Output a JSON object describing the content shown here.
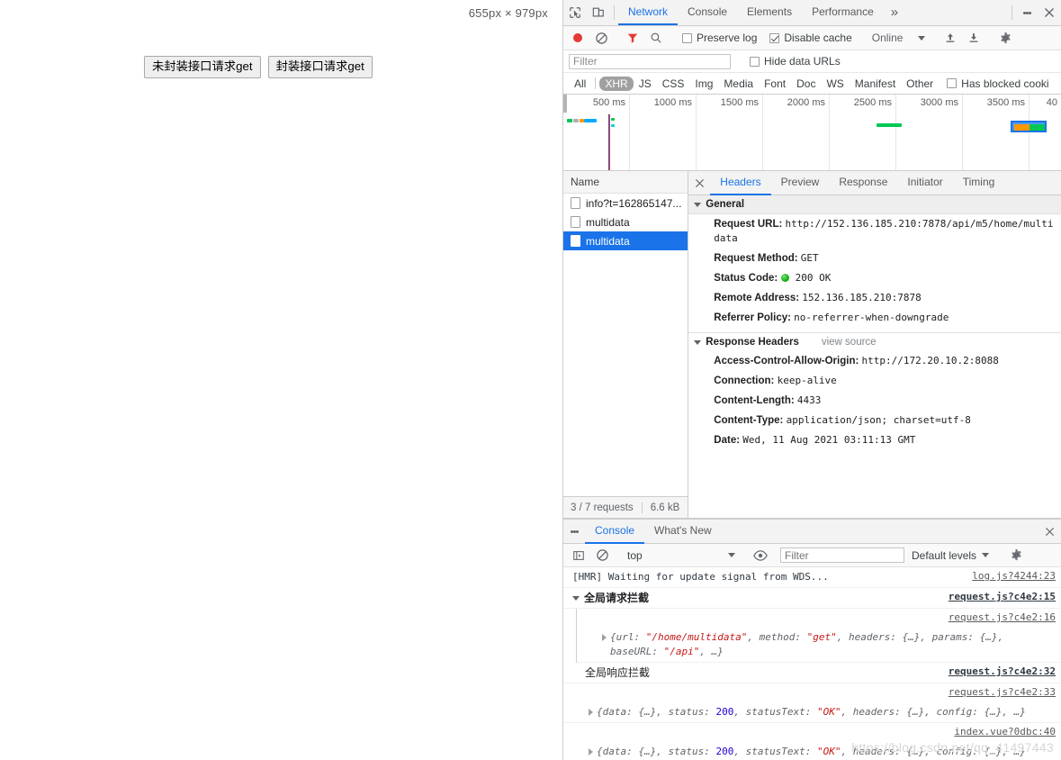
{
  "page": {
    "dimension_badge": "655px × 979px",
    "buttons": [
      {
        "label": "未封装接口请求get"
      },
      {
        "label": "封装接口请求get"
      }
    ]
  },
  "devtools": {
    "main_tabs": [
      {
        "label": "Network",
        "active": true
      },
      {
        "label": "Console",
        "active": false
      },
      {
        "label": "Elements",
        "active": false
      },
      {
        "label": "Performance",
        "active": false
      }
    ],
    "more_tabs_label": "»",
    "icons": {
      "inspect": "inspect-element-icon",
      "device": "device-toolbar-icon",
      "kebab": "more-options-icon",
      "close": "close-devtools-icon"
    },
    "network_toolbar": {
      "record_label": "record-button",
      "clear_label": "clear-button",
      "filter_label": "filter-button",
      "search_label": "search-button",
      "preserve_log": "Preserve log",
      "preserve_log_checked": false,
      "disable_cache": "Disable cache",
      "disable_cache_checked": true,
      "throttling": "Online",
      "import_label": "import-har-icon",
      "export_label": "export-har-icon",
      "settings_label": "settings-icon"
    },
    "filter_row": {
      "filter_placeholder": "Filter",
      "filter_value": "",
      "hide_data_urls": "Hide data URLs",
      "hide_data_urls_checked": false
    },
    "type_filters": [
      {
        "label": "All",
        "active": false
      },
      {
        "label": "XHR",
        "active": true
      },
      {
        "label": "JS",
        "active": false
      },
      {
        "label": "CSS",
        "active": false
      },
      {
        "label": "Img",
        "active": false
      },
      {
        "label": "Media",
        "active": false
      },
      {
        "label": "Font",
        "active": false
      },
      {
        "label": "Doc",
        "active": false
      },
      {
        "label": "WS",
        "active": false
      },
      {
        "label": "Manifest",
        "active": false
      },
      {
        "label": "Other",
        "active": false
      }
    ],
    "blocked_cookies": "Has blocked cooki",
    "blocked_cookies_checked": false,
    "overview": {
      "ticks": [
        "500 ms",
        "1000 ms",
        "1500 ms",
        "2000 ms",
        "2500 ms",
        "3000 ms",
        "3500 ms",
        "40"
      ]
    },
    "requests": {
      "column_name": "Name",
      "rows": [
        {
          "name": "info?t=162865147...",
          "selected": false
        },
        {
          "name": "multidata",
          "selected": false
        },
        {
          "name": "multidata",
          "selected": true
        }
      ],
      "status": {
        "requests": "3 / 7 requests",
        "size": "6.6 kB"
      }
    },
    "details": {
      "tabs": [
        {
          "label": "Headers",
          "active": true
        },
        {
          "label": "Preview",
          "active": false
        },
        {
          "label": "Response",
          "active": false
        },
        {
          "label": "Initiator",
          "active": false
        },
        {
          "label": "Timing",
          "active": false
        }
      ],
      "general": {
        "title": "General",
        "items": [
          {
            "key": "Request URL:",
            "value": "http://152.136.185.210:7878/api/m5/home/multidata"
          },
          {
            "key": "Request Method:",
            "value": "GET"
          },
          {
            "key": "Status Code:",
            "value": "200 OK",
            "has_status_dot": true
          },
          {
            "key": "Remote Address:",
            "value": "152.136.185.210:7878"
          },
          {
            "key": "Referrer Policy:",
            "value": "no-referrer-when-downgrade"
          }
        ]
      },
      "response_headers": {
        "title": "Response Headers",
        "view_source": "view source",
        "items": [
          {
            "key": "Access-Control-Allow-Origin:",
            "value": "http://172.20.10.2:8088"
          },
          {
            "key": "Connection:",
            "value": "keep-alive"
          },
          {
            "key": "Content-Length:",
            "value": "4433"
          },
          {
            "key": "Content-Type:",
            "value": "application/json; charset=utf-8"
          },
          {
            "key": "Date:",
            "value": "Wed, 11 Aug 2021 03:11:13 GMT"
          }
        ]
      }
    },
    "drawer": {
      "tabs": [
        {
          "label": "Console",
          "active": true
        },
        {
          "label": "What's New",
          "active": false
        }
      ],
      "toolbar": {
        "sidebar_label": "console-sidebar-icon",
        "clear_label": "clear-console-icon",
        "context": "top",
        "eye_label": "live-expression-icon",
        "filter_placeholder": "Filter",
        "filter_value": "",
        "levels": "Default levels",
        "settings_label": "console-settings-icon"
      },
      "logs": [
        {
          "type": "plain",
          "message": "[HMR] Waiting for update signal from WDS...",
          "source": "log.js?4244:23"
        },
        {
          "type": "group",
          "message": "全局请求拦截",
          "source": "request.js?c4e2:15"
        },
        {
          "type": "object",
          "source": "request.js?c4e2:16",
          "parts": [
            {
              "t": "{url: ",
              "c": "plain"
            },
            {
              "t": "\"/home/multidata\"",
              "c": "string"
            },
            {
              "t": ", method: ",
              "c": "plain"
            },
            {
              "t": "\"get\"",
              "c": "string"
            },
            {
              "t": ", headers: {…}, params: {…}, baseURL: ",
              "c": "plain"
            },
            {
              "t": "\"/api\"",
              "c": "string"
            },
            {
              "t": ", …}",
              "c": "plain"
            }
          ]
        },
        {
          "type": "group2",
          "message": "全局响应拦截",
          "source": "request.js?c4e2:32"
        },
        {
          "type": "object",
          "source": "request.js?c4e2:33",
          "parts": [
            {
              "t": "{data: {…}, status: ",
              "c": "plain"
            },
            {
              "t": "200",
              "c": "number"
            },
            {
              "t": ", statusText: ",
              "c": "plain"
            },
            {
              "t": "\"OK\"",
              "c": "string"
            },
            {
              "t": ", headers: {…}, config: {…}, …}",
              "c": "plain"
            }
          ]
        },
        {
          "type": "object",
          "source": "index.vue?0dbc:40",
          "parts": [
            {
              "t": "{data: {…}, status: ",
              "c": "plain"
            },
            {
              "t": "200",
              "c": "number"
            },
            {
              "t": ", statusText: ",
              "c": "plain"
            },
            {
              "t": "\"OK\"",
              "c": "string"
            },
            {
              "t": ", headers: {…}, config: {…}, …}",
              "c": "plain"
            }
          ]
        }
      ]
    }
  },
  "watermark": {
    "text": "https://blog.csdn.net/qq_41497443"
  },
  "colors": {
    "accent": "#1a73e8",
    "record_red": "#e53935",
    "status_green": "#17b517",
    "waterfall_blue": "#00aaff",
    "waterfall_green": "#00c853",
    "waterfall_orange": "#ff9800"
  }
}
